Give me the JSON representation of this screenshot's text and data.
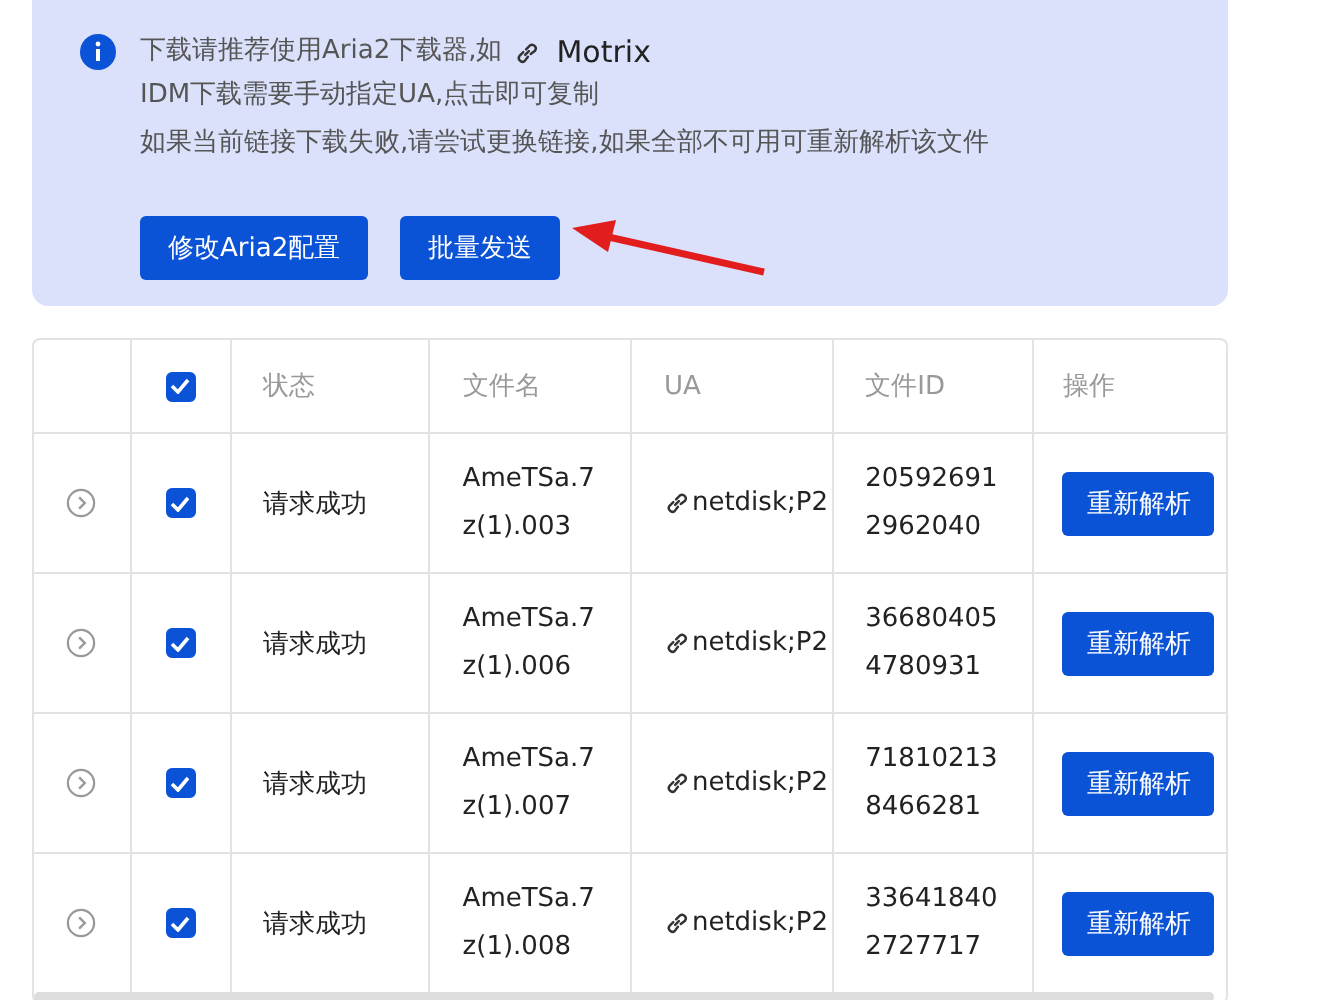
{
  "notice": {
    "lines": [
      "下载请推荐使用Aria2下载器,如",
      "IDM下载需要手动指定UA,点击即可复制",
      "如果当前链接下载失败,请尝试更换链接,如果全部不可用可重新解析该文件"
    ],
    "link": "Motrix",
    "buttons": [
      "修改Aria2配置",
      "批量发送"
    ]
  },
  "table": {
    "all_checked": true,
    "columns": [
      "状态",
      "文件名",
      "UA",
      "文件ID",
      "操作"
    ],
    "rows": [
      {
        "checked": true,
        "status": "请求成功",
        "filename": [
          "AmeTSa.7",
          "z(1).003"
        ],
        "ua": "netdisk;P2",
        "file_id": [
          "20592691",
          "2962040"
        ],
        "action": "重新解析"
      },
      {
        "checked": true,
        "status": "请求成功",
        "filename": [
          "AmeTSa.7",
          "z(1).006"
        ],
        "ua": "netdisk;P2",
        "file_id": [
          "36680405",
          "4780931"
        ],
        "action": "重新解析"
      },
      {
        "checked": true,
        "status": "请求成功",
        "filename": [
          "AmeTSa.7",
          "z(1).007"
        ],
        "ua": "netdisk;P2",
        "file_id": [
          "71810213",
          "8466281"
        ],
        "action": "重新解析"
      },
      {
        "checked": true,
        "status": "请求成功",
        "filename": [
          "AmeTSa.7",
          "z(1).008"
        ],
        "ua": "netdisk;P2",
        "file_id": [
          "33641840",
          "2727717"
        ],
        "action": "重新解析"
      }
    ]
  }
}
